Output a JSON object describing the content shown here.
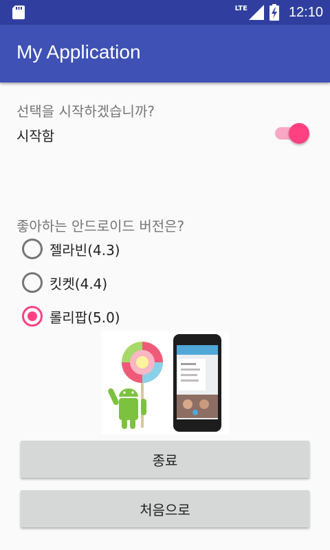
{
  "status_bar": {
    "network": "LTE",
    "time": "12:10",
    "icons": [
      "sd-card-icon",
      "signal-icon",
      "battery-icon"
    ]
  },
  "app_bar": {
    "title": "My Application"
  },
  "start_section": {
    "question": "선택을 시작하겠습니까?",
    "switch_label": "시작함",
    "switch_on": true
  },
  "version_section": {
    "question": "좋아하는 안드로이드 버전은?",
    "options": [
      {
        "label": "젤라빈(4.3)",
        "checked": false
      },
      {
        "label": "킷켓(4.4)",
        "checked": false
      },
      {
        "label": "롤리팝(5.0)",
        "checked": true
      }
    ]
  },
  "buttons": {
    "exit_label": "종료",
    "restart_label": "처음으로"
  },
  "colors": {
    "primary": "#3f51b5",
    "primary_dark": "#303f9f",
    "accent": "#ff4081"
  }
}
